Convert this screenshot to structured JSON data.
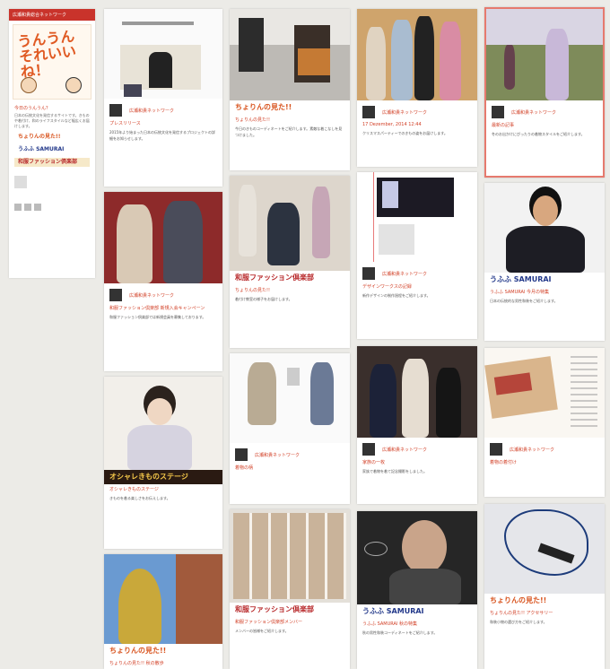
{
  "sidebar": {
    "header": "広瀬和貴総合ネットワーク",
    "logo_text": "うんうん それいいね！",
    "title": "今日のうんうん？",
    "text": "日本の伝統文化を発信するサイトです。きものや着付け、和のライフスタイルなど幅広くお届けします。",
    "banner1": "ちょりんの見た!!",
    "banner2": "うふふ SAMURAI",
    "banner3": "和服ファッション倶楽部"
  },
  "author_label": "広瀬和貴ネットワーク",
  "cards": [
    {
      "title": "プレスリリース",
      "text": "2015年より始まった日本の伝統文化を発信するプロジェクトの詳細をお知らせします。"
    },
    {
      "title": "ちょりんの見た!!",
      "text": "今日のきものコーディネートをご紹介します。素敵な着こなしを見つけました。"
    },
    {
      "title": "17 Dezember, 2014 12:44",
      "text": "クリスマスパーティーでのきもの姿をお届けします。"
    },
    {
      "title": "最新の記事",
      "text": "冬のお出かけにぴったりの着物スタイルをご紹介します。"
    },
    {
      "title": "和服ファッション倶楽部 新規入会キャンペーン",
      "text": "和服ファッション倶楽部では新規会員を募集しております。"
    },
    {
      "title": "ちょりんの見た!!",
      "text": "着付け教室の様子をお届けします。"
    },
    {
      "title": "デザインワークスの記録",
      "text": "新作デザインの制作過程をご紹介します。"
    },
    {
      "title": "うふふ SAMURAI 今月の特集",
      "text": "日本の伝統的な男性和装をご紹介します。"
    },
    {
      "title": "オシャレきものステージ",
      "text": "きものを着る楽しさをお伝えします。"
    },
    {
      "title": "着物の柄",
      "text": "季節ごとの柄の選び方をご紹介します。"
    },
    {
      "title": "家族の一枚",
      "text": "家族で着物を着て記念撮影をしました。"
    },
    {
      "title": "着物の着付け",
      "text": "帯の結び方を詳しく解説します。"
    },
    {
      "title": "和服ファッション倶楽部メンバー",
      "text": "メンバーの皆様をご紹介します。"
    },
    {
      "title": "うふふ SAMURAI 秋の特集",
      "text": "秋の男性和装コーディネートをご紹介します。"
    },
    {
      "title": "ちょりんの見た!! アクセサリー",
      "text": "和装小物の選び方をご紹介します。"
    },
    {
      "title": "ちょりんの見た!! 秋の散歩",
      "text": "秋の銀杏並木を着物で散歩しました。"
    }
  ],
  "banners": {
    "chorin": "ちょりんの見た!!",
    "samurai": "うふふ SAMURAI",
    "kiki": "和服ファッション倶楽部",
    "okazu": "オシャレきものステージ"
  }
}
